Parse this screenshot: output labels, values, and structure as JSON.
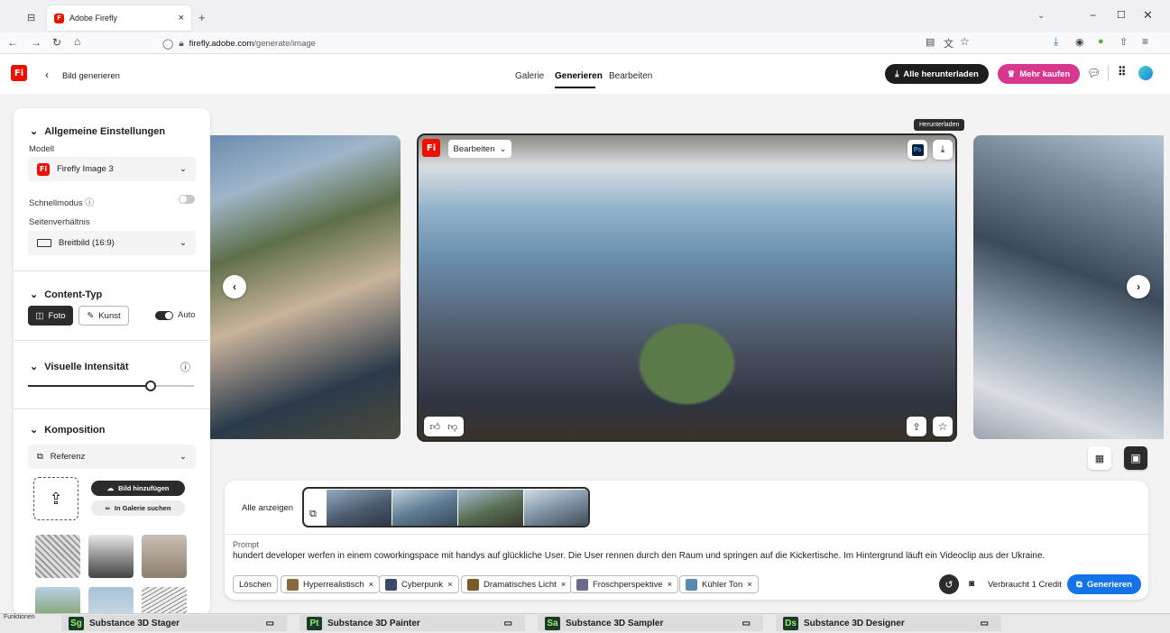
{
  "browser": {
    "tab_title": "Adobe Firefly",
    "new_tab": "+",
    "url_domain": "firefly.adobe.com",
    "url_path": "/generate/image"
  },
  "header": {
    "back_label": "Bild generieren",
    "nav": [
      "Galerie",
      "Generieren",
      "Bearbeiten"
    ],
    "download_all": "Alle herunterladen",
    "buy_more": "Mehr kaufen"
  },
  "sidebar": {
    "general_title": "Allgemeine Einstellungen",
    "model_label": "Modell",
    "model_value": "Firefly Image 3",
    "fast_mode_label": "Schnellmodus",
    "aspect_label": "Seitenverhältnis",
    "aspect_value": "Breitbild (16:9)",
    "content_type_title": "Content-Typ",
    "photo_label": "Foto",
    "art_label": "Kunst",
    "auto_label": "Auto",
    "visual_intensity_title": "Visuelle Intensität",
    "composition_title": "Komposition",
    "reference_label": "Referenz",
    "add_image_label": "Bild hinzufügen",
    "search_gallery_label": "In Galerie suchen"
  },
  "main": {
    "edit_label": "Bearbeiten",
    "tooltip_download": "Herunterladen",
    "ps_label": "Ps"
  },
  "bottom": {
    "show_all": "Alle anzeigen",
    "prompt_label": "Prompt",
    "prompt_text": "hundert developer werfen in einem coworkingspace mit handys auf glückliche User. Die User rennen durch den Raum und springen auf die Kickertische. Im Hintergrund läuft ein Videoclip aus der Ukraine.",
    "clear_label": "Löschen",
    "chips": [
      {
        "label": "Hyperrealistisch",
        "color": "#8a6a3a"
      },
      {
        "label": "Cyberpunk",
        "color": "#3a4a6a"
      },
      {
        "label": "Dramatisches Licht",
        "color": "#7a5a2a"
      },
      {
        "label": "Froschperspektive",
        "color": "#6a6a8a"
      },
      {
        "label": "Kühler Ton",
        "color": "#5a8ab0"
      }
    ],
    "credit_label": "Verbraucht 1 Credit",
    "generate_label": "Generieren"
  },
  "taskbar": {
    "functions_label": "Funktionen",
    "apps": [
      {
        "abbr": "Sg",
        "name": "Substance 3D Stager",
        "color": "#1a3a2a",
        "text": "#9fe870"
      },
      {
        "abbr": "Pt",
        "name": "Substance 3D Painter",
        "color": "#1a3a2a",
        "text": "#9fe870"
      },
      {
        "abbr": "Sa",
        "name": "Substance 3D Sampler",
        "color": "#1a3a2a",
        "text": "#9fe870"
      },
      {
        "abbr": "Ds",
        "name": "Substance 3D Designer",
        "color": "#1a3a2a",
        "text": "#9fe870"
      }
    ]
  },
  "colors": {
    "brand_red": "#eb1000",
    "generate_blue": "#1473e6",
    "buy_pink": "#d83790"
  }
}
